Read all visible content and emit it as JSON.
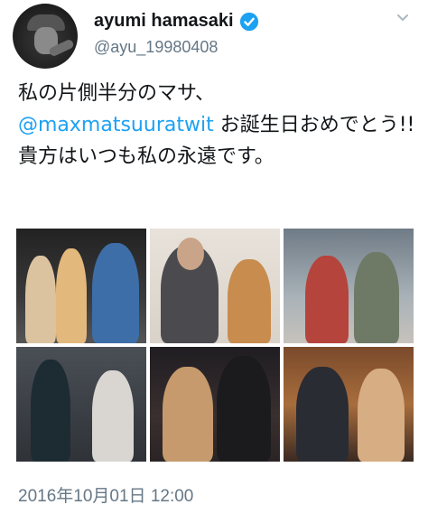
{
  "tweet": {
    "display_name": "ayumi hamasaki",
    "handle": "@ayu_19980408",
    "text_line1": "私の片側半分のマサ、",
    "mention": "@maxmatsuuratwit",
    "text_after_mention": " お誕生日おめでとう!! 貴方はいつも私の永遠です。",
    "timestamp": "2016年10月01日 12:00"
  },
  "icons": {
    "verified": "verified-badge-icon",
    "menu": "chevron-down-icon"
  },
  "photos": [
    {
      "name": "photo-1"
    },
    {
      "name": "photo-2"
    },
    {
      "name": "photo-3"
    },
    {
      "name": "photo-4"
    },
    {
      "name": "photo-5"
    },
    {
      "name": "photo-6"
    }
  ],
  "colors": {
    "mention": "#1da1f2",
    "verified": "#1da1f2",
    "muted": "#657786"
  }
}
